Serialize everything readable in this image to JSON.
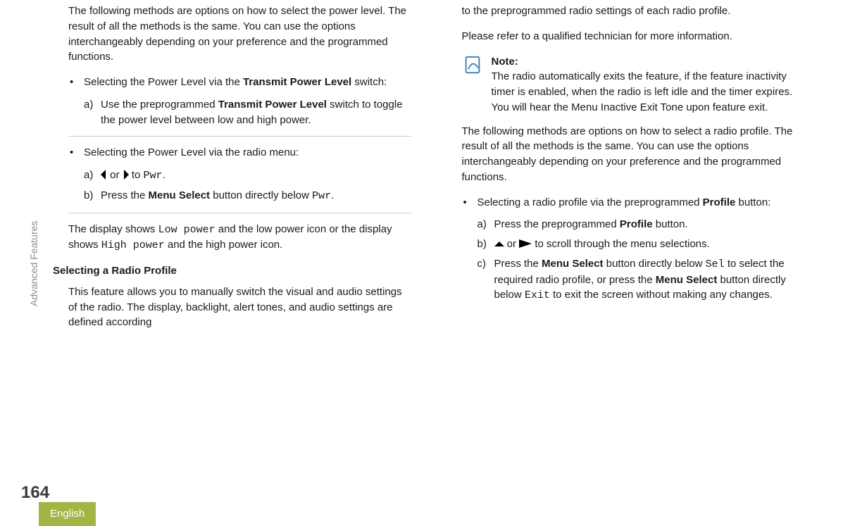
{
  "sidebar_text": "Advanced Features",
  "page_number": "164",
  "lang_tab": "English",
  "col1": {
    "intro": "The following methods are options on how to select the power level. The result of all the methods is the same. You can use the options interchangeably depending on your preference and the programmed functions.",
    "item1_lead": "Selecting the Power Level via the ",
    "item1_bold": "Transmit Power Level",
    "item1_tail": " switch:",
    "item1_a_lead": "Use the preprogrammed ",
    "item1_a_bold": "Transmit Power Level",
    "item1_a_tail": " switch to toggle the power level between low and high power.",
    "item2_text": "Selecting the Power Level via the radio menu:",
    "item2_a_mid": " or ",
    "item2_a_to": " to ",
    "item2_a_pwr": "Pwr",
    "item2_a_end": ".",
    "item2_b_lead": "Press the ",
    "item2_b_bold": "Menu Select",
    "item2_b_mid": " button directly below ",
    "item2_b_pwr": "Pwr",
    "item2_b_end": ".",
    "display_lead": "The display shows ",
    "display_low": "Low power",
    "display_mid1": " and the low power icon or the display shows ",
    "display_high": "High power",
    "display_tail": " and the high power icon.",
    "heading2": "Selecting a Radio Profile",
    "profile_p1": "This feature allows you to manually switch the visual and audio settings of the radio. The display, backlight, alert tones, and audio settings are defined according"
  },
  "col2": {
    "p1": "to the preprogrammed radio settings of each radio profile.",
    "p2": "Please refer to a qualified technician for more information.",
    "note_label": "Note:",
    "note_text": "The radio automatically exits the feature, if the feature inactivity timer is enabled, when the radio is left idle and the timer expires. You will hear the Menu Inactive Exit Tone upon feature exit.",
    "p3": "The following methods are options on how to select a radio profile. The result of all the methods is the same. You can use the options interchangeably depending on your preference and the programmed functions.",
    "item1_lead": "Selecting a radio profile via the preprogrammed ",
    "item1_bold": "Profile",
    "item1_tail": " button:",
    "a_lead": "Press the preprogrammed ",
    "a_bold": "Profile",
    "a_tail": " button.",
    "b_mid": " or ",
    "b_tail": " to scroll through the menu selections.",
    "c_lead": "Press the ",
    "c_bold1": "Menu Select",
    "c_mid1": " button directly below ",
    "c_sel": "Sel",
    "c_mid2": " to select the required radio profile, or press the ",
    "c_bold2": "Menu Select",
    "c_mid3": " button directly below ",
    "c_exit": "Exit",
    "c_tail": " to exit the screen without making any changes."
  }
}
